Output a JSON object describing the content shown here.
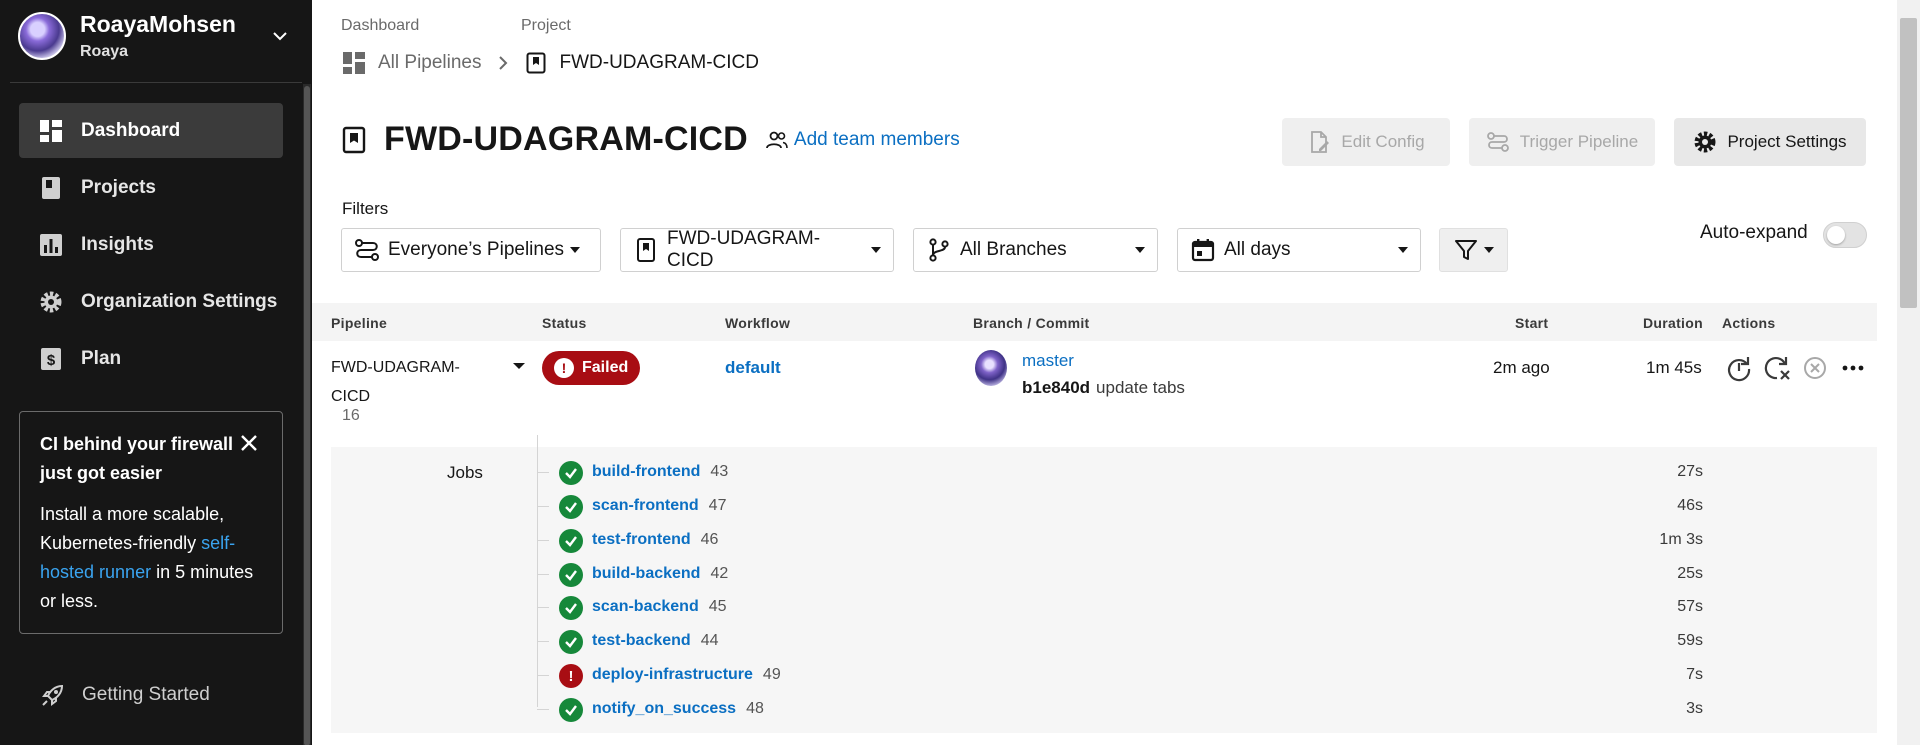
{
  "org": {
    "name": "RoayaMohsen",
    "user": "Roaya"
  },
  "sidebar": {
    "items": [
      {
        "label": "Dashboard",
        "icon": "dashboard-icon",
        "active": true
      },
      {
        "label": "Projects",
        "icon": "projects-icon"
      },
      {
        "label": "Insights",
        "icon": "insights-icon"
      },
      {
        "label": "Organization Settings",
        "icon": "gear-icon"
      },
      {
        "label": "Plan",
        "icon": "plan-icon"
      }
    ],
    "promo": {
      "title": "CI behind your firewall just got easier",
      "body_prefix": "Install a more scalable, Kubernetes-friendly ",
      "link": "self-hosted runner",
      "body_suffix": " in 5 minutes or less."
    },
    "getting_started": "Getting Started"
  },
  "breadcrumb": {
    "label1": "Dashboard",
    "label2": "Project",
    "item1": "All Pipelines",
    "item2": "FWD-UDAGRAM-CICD"
  },
  "header": {
    "title": "FWD-UDAGRAM-CICD",
    "add_team": "Add team members",
    "edit_config": "Edit Config",
    "trigger_pipeline": "Trigger Pipeline",
    "project_settings": "Project Settings"
  },
  "filters": {
    "label": "Filters",
    "pipelines": "Everyone’s Pipelines",
    "project": "FWD-UDAGRAM-CICD",
    "branches": "All Branches",
    "days": "All days",
    "auto_expand": "Auto-expand",
    "auto_expand_on": false
  },
  "table": {
    "headers": {
      "pipeline": "Pipeline",
      "status": "Status",
      "workflow": "Workflow",
      "branch": "Branch / Commit",
      "start": "Start",
      "duration": "Duration",
      "actions": "Actions"
    },
    "row": {
      "pipeline": "FWD-UDAGRAM-CICD",
      "number": "16",
      "status": "Failed",
      "workflow": "default",
      "branch": "master",
      "sha": "b1e840d",
      "message": "update tabs",
      "start": "2m ago",
      "duration": "1m 45s"
    },
    "jobs_label": "Jobs",
    "jobs": [
      {
        "name": "build-frontend",
        "number": "43",
        "duration": "27s",
        "status": "success"
      },
      {
        "name": "scan-frontend",
        "number": "47",
        "duration": "46s",
        "status": "success"
      },
      {
        "name": "test-frontend",
        "number": "46",
        "duration": "1m 3s",
        "status": "success"
      },
      {
        "name": "build-backend",
        "number": "42",
        "duration": "25s",
        "status": "success"
      },
      {
        "name": "scan-backend",
        "number": "45",
        "duration": "57s",
        "status": "success"
      },
      {
        "name": "test-backend",
        "number": "44",
        "duration": "59s",
        "status": "success"
      },
      {
        "name": "deploy-infrastructure",
        "number": "49",
        "duration": "7s",
        "status": "failed"
      },
      {
        "name": "notify_on_success",
        "number": "48",
        "duration": "3s",
        "status": "success"
      }
    ]
  },
  "colors": {
    "link": "#0b6fc2",
    "failed": "#a80d13",
    "success": "#16883a",
    "sidebar_bg": "#161616"
  }
}
